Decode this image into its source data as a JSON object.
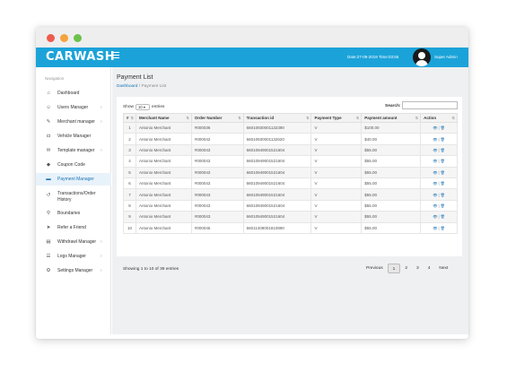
{
  "app": {
    "brand": "CARWASH",
    "datetime": "Date:27-09-2019 Time:03:55",
    "user": "Super Admin"
  },
  "sidebar": {
    "heading": "Navigation",
    "items": [
      {
        "label": "Dashboard",
        "icon": "home-icon",
        "glyph": "⌂",
        "has_children": false
      },
      {
        "label": "Users Manager",
        "icon": "user-icon",
        "glyph": "☺",
        "has_children": true
      },
      {
        "label": "Merchant manager",
        "icon": "merchant-icon",
        "glyph": "✎",
        "has_children": true
      },
      {
        "label": "Vehicle Manager",
        "icon": "car-icon",
        "glyph": "◘",
        "has_children": false
      },
      {
        "label": "Template manager",
        "icon": "template-icon",
        "glyph": "✉",
        "has_children": true
      },
      {
        "label": "Coupon Code",
        "icon": "tag-icon",
        "glyph": "◆",
        "has_children": false
      },
      {
        "label": "Payment Manager",
        "icon": "card-icon",
        "glyph": "▬",
        "has_children": false,
        "active": true
      },
      {
        "label": "Transactions/Order History",
        "icon": "history-icon",
        "glyph": "↺",
        "has_children": false
      },
      {
        "label": "Boundaries",
        "icon": "pin-icon",
        "glyph": "⚲",
        "has_children": false
      },
      {
        "label": "Refer a Friend",
        "icon": "refer-icon",
        "glyph": "➤",
        "has_children": false
      },
      {
        "label": "Withdrawl Manager",
        "icon": "withdraw-icon",
        "glyph": "▤",
        "has_children": true
      },
      {
        "label": "Logs Manager",
        "icon": "logs-icon",
        "glyph": "☰",
        "has_children": true
      },
      {
        "label": "Settings Manager",
        "icon": "gear-icon",
        "glyph": "⚙",
        "has_children": true
      }
    ]
  },
  "page": {
    "title": "Payment List",
    "breadcrumb_home": "Dashboard",
    "breadcrumb_sep": "/",
    "breadcrumb_current": "Payment List"
  },
  "table_controls": {
    "show": "Show",
    "entries_value": "10",
    "entries": "entries",
    "search": "Search:",
    "search_value": ""
  },
  "table": {
    "columns": [
      "#",
      "Merchant Name",
      "Order Number",
      "Transaction id",
      "Payment Type",
      "Payment amount",
      "Action"
    ],
    "rows": [
      [
        "1",
        "Antonio Merchant",
        "#000036",
        "66010930001132390",
        "V",
        "$100.00"
      ],
      [
        "2",
        "Antonio Merchant",
        "#000042",
        "66010930001132620",
        "V",
        "$40.00"
      ],
      [
        "3",
        "Antonio Merchant",
        "#000043",
        "66010949001521604",
        "V",
        "$55.00"
      ],
      [
        "4",
        "Antonio Merchant",
        "#000043",
        "66010949001521604",
        "V",
        "$55.00"
      ],
      [
        "5",
        "Antonio Merchant",
        "#000043",
        "66010949001521604",
        "V",
        "$55.00"
      ],
      [
        "6",
        "Antonio Merchant",
        "#000043",
        "66010949001521604",
        "V",
        "$55.00"
      ],
      [
        "7",
        "Antonio Merchant",
        "#000043",
        "66010949001521604",
        "V",
        "$55.00"
      ],
      [
        "8",
        "Antonio Merchant",
        "#000043",
        "66010949001521604",
        "V",
        "$55.00"
      ],
      [
        "9",
        "Antonio Merchant",
        "#000043",
        "66010949001521604",
        "V",
        "$55.00"
      ],
      [
        "10",
        "Antonio Merchant",
        "#000046",
        "66011408001810890",
        "V",
        "$55.00"
      ]
    ],
    "action_view": "👁",
    "action_sep": "|",
    "action_delete": "🗑"
  },
  "footer": {
    "info": "Showing 1 to 10 of 39 entries",
    "prev": "Previous",
    "pages": [
      "1",
      "2",
      "3",
      "4"
    ],
    "next": "Next",
    "current_page": "1"
  },
  "colors": {
    "topbar": "#1ba3d9",
    "active_bg": "#e8f2fa",
    "link": "#1a73b5"
  }
}
